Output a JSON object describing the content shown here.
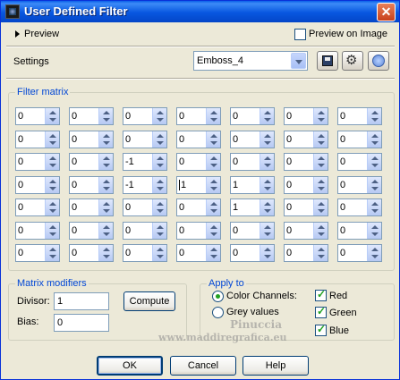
{
  "window": {
    "title": "User Defined Filter",
    "close_glyph": "✕"
  },
  "preview_row": {
    "toggle_label": "Preview",
    "preview_on_image_label": "Preview on Image",
    "preview_on_image_checked": false
  },
  "settings": {
    "label": "Settings",
    "preset_value": "Emboss_4",
    "buttons": {
      "save_icon": "save-icon",
      "manage_icon": "manage-presets-icon",
      "reset_icon": "reset-icon"
    }
  },
  "filter_matrix": {
    "label": "Filter matrix",
    "rows": [
      [
        "0",
        "0",
        "0",
        "0",
        "0",
        "0",
        "0"
      ],
      [
        "0",
        "0",
        "0",
        "0",
        "0",
        "0",
        "0"
      ],
      [
        "0",
        "0",
        "-1",
        "0",
        "0",
        "0",
        "0"
      ],
      [
        "0",
        "0",
        "-1",
        "1",
        "1",
        "0",
        "0"
      ],
      [
        "0",
        "0",
        "0",
        "0",
        "1",
        "0",
        "0"
      ],
      [
        "0",
        "0",
        "0",
        "0",
        "0",
        "0",
        "0"
      ],
      [
        "0",
        "0",
        "0",
        "0",
        "0",
        "0",
        "0"
      ]
    ]
  },
  "matrix_modifiers": {
    "label": "Matrix modifiers",
    "divisor_label": "Divisor:",
    "divisor_value": "1",
    "bias_label": "Bias:",
    "bias_value": "0",
    "compute_label": "Compute"
  },
  "apply_to": {
    "label": "Apply to",
    "color_channels_label": "Color Channels:",
    "color_channels_selected": true,
    "grey_values_label": "Grey values",
    "grey_values_selected": false,
    "red_label": "Red",
    "green_label": "Green",
    "blue_label": "Blue"
  },
  "footer": {
    "ok_label": "OK",
    "cancel_label": "Cancel",
    "help_label": "Help"
  },
  "watermark": {
    "line1": "Pinuccia",
    "line2": "www.maddiregrafica.eu"
  },
  "colors": {
    "title_bar": "#0857e0",
    "group_label": "#0046d5",
    "dialog_bg": "#ece9d8",
    "check_green": "#21a121"
  }
}
